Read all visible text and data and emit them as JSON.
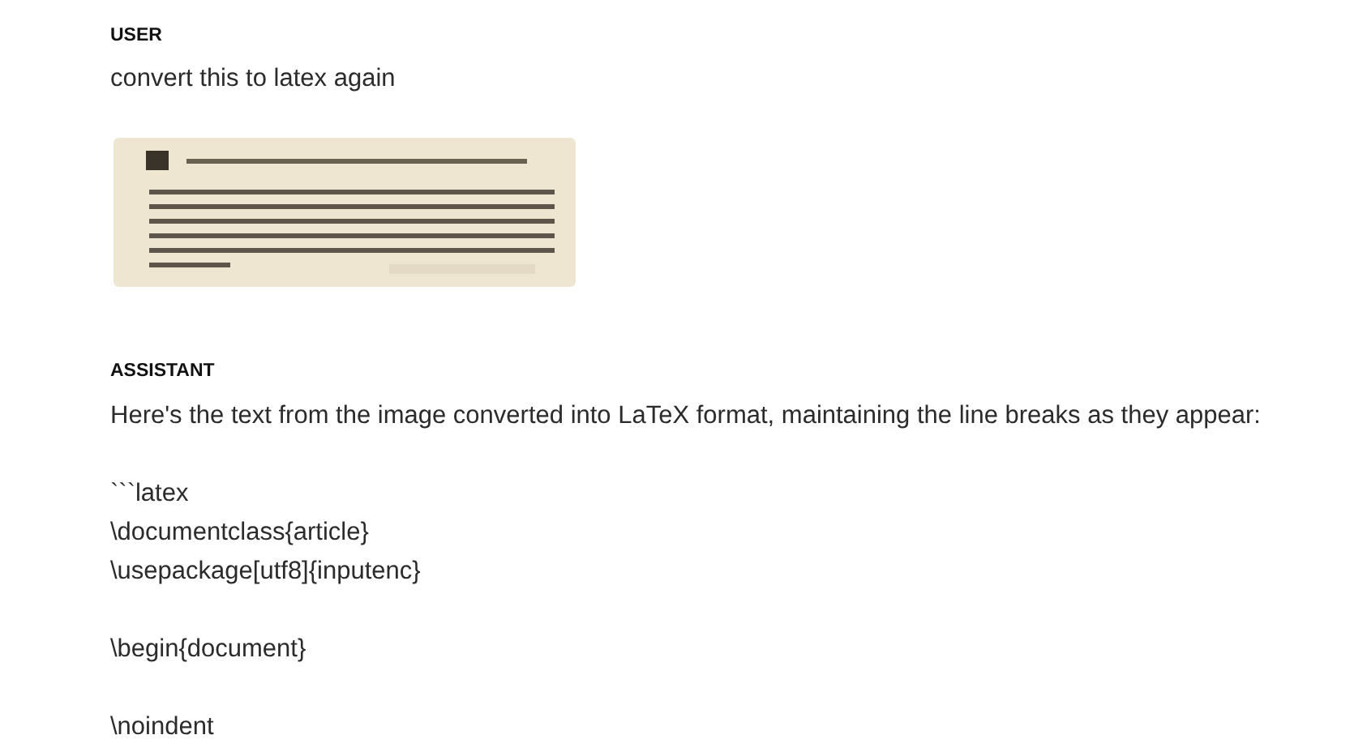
{
  "messages": [
    {
      "role": "USER",
      "paragraphs": [
        "convert this to latex again"
      ],
      "attachment": {
        "kind": "picture"
      }
    },
    {
      "role": "ASSISTANT",
      "paragraphs": [
        "Here's the text from the image converted into LaTeX format, maintaining the line breaks as they appear:",
        "```latex\n\\documentclass{article}\n\\usepackage[utf8]{inputenc}",
        "\\begin{document}",
        "\\noindent"
      ]
    }
  ]
}
